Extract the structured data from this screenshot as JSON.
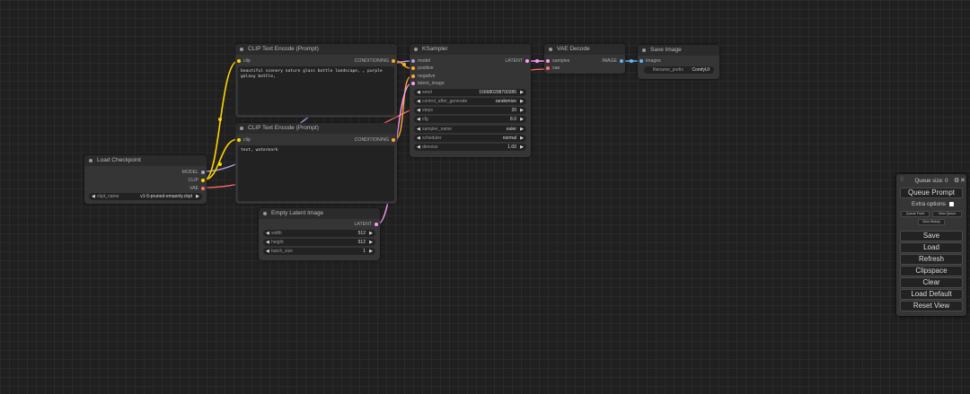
{
  "colors": {
    "clip": "#ffd500",
    "conditioning": "#ffa931",
    "model": "#b39ddb",
    "latent": "#ff9cf9",
    "vae": "#ff6e6e",
    "image": "#64b5f6"
  },
  "nodes": {
    "clip_pos": {
      "title": "CLIP Text Encode (Prompt)",
      "input_clip": "clip",
      "output": "CONDITIONING",
      "text": "beautiful scenery nature glass bottle landscape, , purple galaxy bottle,"
    },
    "clip_neg": {
      "title": "CLIP Text Encode (Prompt)",
      "input_clip": "clip",
      "output": "CONDITIONING",
      "text": "text, watermark"
    },
    "ksampler": {
      "title": "KSampler",
      "inputs": [
        "model",
        "positive",
        "negative",
        "latent_image"
      ],
      "output": "LATENT",
      "widgets": [
        {
          "label": "seed",
          "value": "156680208700286"
        },
        {
          "label": "control_after_generate",
          "value": "randomize"
        },
        {
          "label": "steps",
          "value": "20"
        },
        {
          "label": "cfg",
          "value": "8.0"
        },
        {
          "label": "sampler_name",
          "value": "euler"
        },
        {
          "label": "scheduler",
          "value": "normal"
        },
        {
          "label": "denoise",
          "value": "1.00"
        }
      ]
    },
    "vae_decode": {
      "title": "VAE Decode",
      "inputs": [
        "samples",
        "vae"
      ],
      "output": "IMAGE"
    },
    "save_image": {
      "title": "Save Image",
      "input": "images",
      "widget": {
        "label": "filename_prefix",
        "value": "ComfyUI"
      }
    },
    "load_checkpoint": {
      "title": "Load Checkpoint",
      "outputs": [
        "MODEL",
        "CLIP",
        "VAE"
      ],
      "widget": {
        "label": "ckpt_name",
        "value": "v1-5-pruned-emaonly.ckpt"
      }
    },
    "empty_latent": {
      "title": "Empty Latent Image",
      "output": "LATENT",
      "widgets": [
        {
          "label": "width",
          "value": "512"
        },
        {
          "label": "height",
          "value": "512"
        },
        {
          "label": "batch_size",
          "value": "1"
        }
      ]
    }
  },
  "panel": {
    "queue_size": "Queue size: 0",
    "queue_prompt": "Queue Prompt",
    "extra_options": "Extra options",
    "queue_front": "Queue Front",
    "view_queue": "View Queue",
    "view_history": "View History",
    "save": "Save",
    "load": "Load",
    "refresh": "Refresh",
    "clipspace": "Clipspace",
    "clear": "Clear",
    "load_default": "Load Default",
    "reset_view": "Reset View"
  }
}
